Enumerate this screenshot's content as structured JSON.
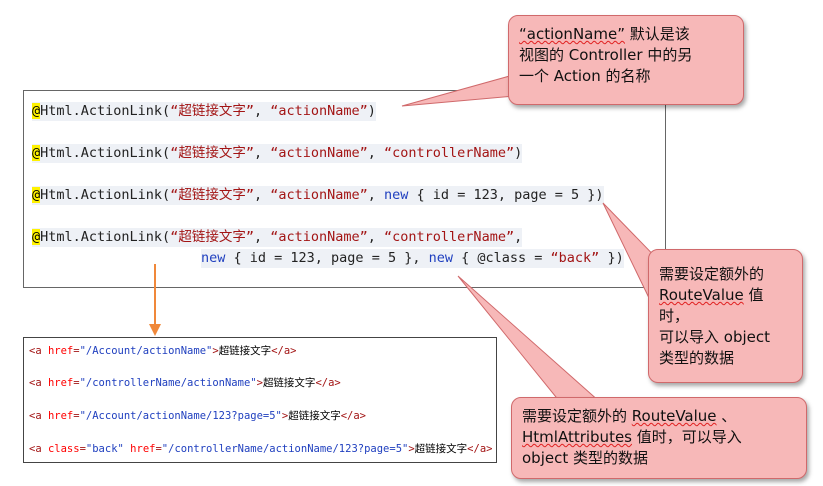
{
  "razor_lines": [
    [
      "@",
      "Html.ActionLink(",
      "“超链接文字”",
      ", ",
      "“actionName”",
      ")"
    ],
    [
      "@",
      "Html.ActionLink(",
      "“超链接文字”",
      ", ",
      "“actionName”",
      ", ",
      "“controllerName”",
      ")"
    ],
    [
      "@",
      "Html.ActionLink(",
      "“超链接文字”",
      ", ",
      "“actionName”",
      ", ",
      "new",
      " { id = 123, page = 5 })"
    ],
    [
      "@",
      "Html.ActionLink(",
      "“超链接文字”",
      ", ",
      "“actionName”",
      ", ",
      "“controllerName”",
      ","
    ],
    [
      "new",
      " { id = 123, page = 5 }, ",
      "new",
      " { @class = ",
      "“back”",
      " })"
    ]
  ],
  "html_lines": [
    [
      "<a ",
      "href",
      "=",
      "\"/Account/actionName\"",
      ">",
      "超链接文字",
      "</a>"
    ],
    [
      "<a ",
      "href",
      "=",
      "\"/controllerName/actionName\"",
      ">",
      "超链接文字",
      "</a>"
    ],
    [
      "<a ",
      "href",
      "=",
      "\"/Account/actionName/123?page=5\"",
      ">",
      "超链接文字",
      "</a>"
    ],
    [
      "<a ",
      "class",
      "=",
      "\"back\"",
      " ",
      "href",
      "=",
      "\"/controllerName/actionName/123?page=5\"",
      ">",
      "超链接文字",
      "</a>"
    ]
  ],
  "callouts": {
    "action_name": {
      "line1_quoted": "“actionName”",
      "line1_rest": " 默认是该",
      "line2": "视图的 Controller 中的另",
      "line3": "一个 Action 的名称"
    },
    "route_value": {
      "line1": "需要设定额外的",
      "line2_word": "RouteValue",
      "line2_rest": " 值时，",
      "line3": "可以导入 object",
      "line4": "类型的数据"
    },
    "html_attributes": {
      "line1_prefix": "需要设定额外的 ",
      "line1_word": "RouteValue",
      "line1_suffix": " 、",
      "line2_word": "HtmlAttributes",
      "line2_rest": " 值时，可以导入",
      "line3": "object 类型的数据"
    }
  },
  "colors": {
    "callout_fill": "#f7b8b8",
    "callout_border": "#d0696b",
    "arrow": "#f0883a",
    "string": "#a31515",
    "keyword": "#1f3fbf",
    "highlight": "#fff200"
  }
}
